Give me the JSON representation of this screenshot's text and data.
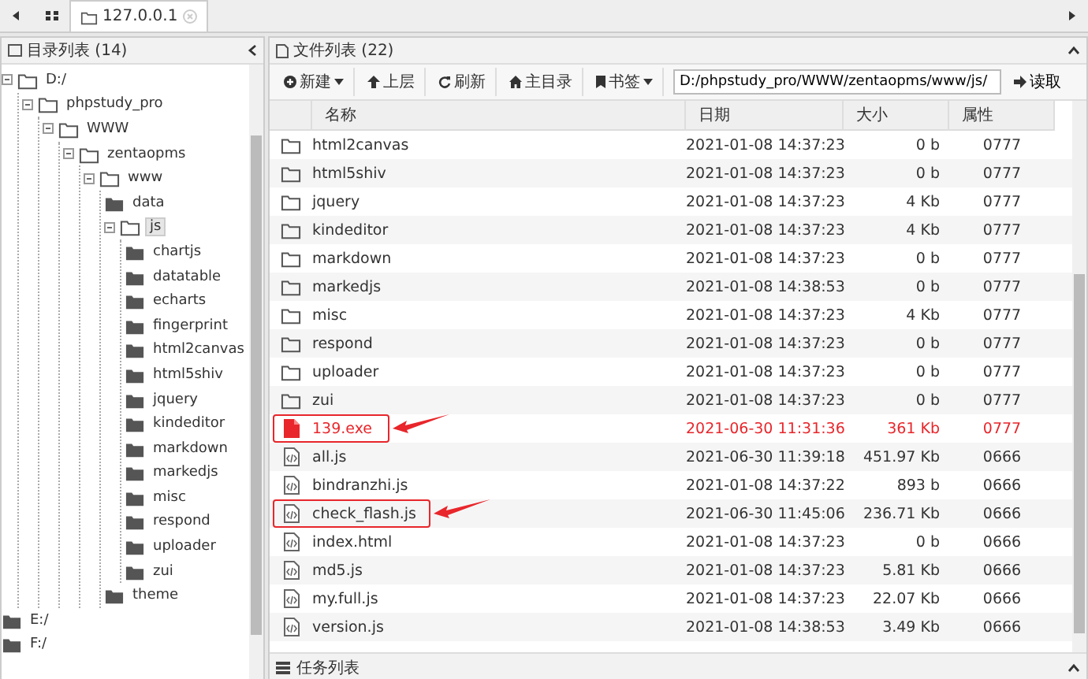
{
  "tabs": [
    {
      "label": "127.0.0.1",
      "selected": true
    }
  ],
  "directory_panel": {
    "title": "目录列表 (14)",
    "tree": [
      {
        "label": "D:/",
        "expanded": true,
        "selected": false,
        "children": [
          {
            "label": "phpstudy_pro",
            "expanded": true,
            "selected": false,
            "children": [
              {
                "label": "WWW",
                "expanded": true,
                "selected": false,
                "children": [
                  {
                    "label": "zentaopms",
                    "expanded": true,
                    "selected": false,
                    "children": [
                      {
                        "label": "www",
                        "expanded": true,
                        "selected": false,
                        "children": [
                          {
                            "label": "data",
                            "expanded": false,
                            "selected": false
                          },
                          {
                            "label": "js",
                            "expanded": true,
                            "selected": true,
                            "children": [
                              {
                                "label": "chartjs",
                                "expanded": false,
                                "selected": false
                              },
                              {
                                "label": "datatable",
                                "expanded": false,
                                "selected": false
                              },
                              {
                                "label": "echarts",
                                "expanded": false,
                                "selected": false
                              },
                              {
                                "label": "fingerprint",
                                "expanded": false,
                                "selected": false
                              },
                              {
                                "label": "html2canvas",
                                "expanded": false,
                                "selected": false
                              },
                              {
                                "label": "html5shiv",
                                "expanded": false,
                                "selected": false
                              },
                              {
                                "label": "jquery",
                                "expanded": false,
                                "selected": false
                              },
                              {
                                "label": "kindeditor",
                                "expanded": false,
                                "selected": false
                              },
                              {
                                "label": "markdown",
                                "expanded": false,
                                "selected": false
                              },
                              {
                                "label": "markedjs",
                                "expanded": false,
                                "selected": false
                              },
                              {
                                "label": "misc",
                                "expanded": false,
                                "selected": false
                              },
                              {
                                "label": "respond",
                                "expanded": false,
                                "selected": false
                              },
                              {
                                "label": "uploader",
                                "expanded": false,
                                "selected": false
                              },
                              {
                                "label": "zui",
                                "expanded": false,
                                "selected": false
                              }
                            ]
                          },
                          {
                            "label": "theme",
                            "expanded": false,
                            "selected": false
                          }
                        ]
                      }
                    ]
                  }
                ]
              }
            ]
          }
        ]
      },
      {
        "label": "E:/",
        "expanded": false,
        "selected": false
      },
      {
        "label": "F:/",
        "expanded": false,
        "selected": false
      }
    ]
  },
  "file_panel": {
    "title": "文件列表 (22)",
    "toolbar": [
      {
        "label": "新建",
        "kind": "new",
        "dropdown": true
      },
      {
        "label": "上层",
        "kind": "up",
        "dropdown": false
      },
      {
        "label": "刷新",
        "kind": "refresh",
        "dropdown": false
      },
      {
        "label": "主目录",
        "kind": "home",
        "dropdown": false
      },
      {
        "label": "书签",
        "kind": "bookmark",
        "dropdown": true
      }
    ],
    "path": "D:/phpstudy_pro/WWW/zentaopms/www/js/",
    "read_button": "读取",
    "columns": [
      "名称",
      "日期",
      "大小",
      "属性"
    ],
    "rows": [
      {
        "kind": "folder",
        "name": "html2canvas",
        "date": "2021-01-08 14:37:23",
        "size": "0 b",
        "mode": "0777",
        "highlighted": false
      },
      {
        "kind": "folder",
        "name": "html5shiv",
        "date": "2021-01-08 14:37:23",
        "size": "0 b",
        "mode": "0777",
        "highlighted": false
      },
      {
        "kind": "folder",
        "name": "jquery",
        "date": "2021-01-08 14:37:23",
        "size": "4 Kb",
        "mode": "0777",
        "highlighted": false
      },
      {
        "kind": "folder",
        "name": "kindeditor",
        "date": "2021-01-08 14:37:23",
        "size": "4 Kb",
        "mode": "0777",
        "highlighted": false
      },
      {
        "kind": "folder",
        "name": "markdown",
        "date": "2021-01-08 14:37:23",
        "size": "0 b",
        "mode": "0777",
        "highlighted": false
      },
      {
        "kind": "folder",
        "name": "markedjs",
        "date": "2021-01-08 14:38:53",
        "size": "0 b",
        "mode": "0777",
        "highlighted": false
      },
      {
        "kind": "folder",
        "name": "misc",
        "date": "2021-01-08 14:37:23",
        "size": "4 Kb",
        "mode": "0777",
        "highlighted": false
      },
      {
        "kind": "folder",
        "name": "respond",
        "date": "2021-01-08 14:37:23",
        "size": "0 b",
        "mode": "0777",
        "highlighted": false
      },
      {
        "kind": "folder",
        "name": "uploader",
        "date": "2021-01-08 14:37:23",
        "size": "0 b",
        "mode": "0777",
        "highlighted": false
      },
      {
        "kind": "folder",
        "name": "zui",
        "date": "2021-01-08 14:37:23",
        "size": "0 b",
        "mode": "0777",
        "highlighted": false
      },
      {
        "kind": "executable",
        "name": "139.exe",
        "date": "2021-06-30 11:31:36",
        "size": "361 Kb",
        "mode": "0777",
        "highlighted": true
      },
      {
        "kind": "script",
        "name": "all.js",
        "date": "2021-06-30 11:39:18",
        "size": "451.97 Kb",
        "mode": "0666",
        "highlighted": false
      },
      {
        "kind": "script",
        "name": "bindranzhi.js",
        "date": "2021-01-08 14:37:22",
        "size": "893 b",
        "mode": "0666",
        "highlighted": false
      },
      {
        "kind": "script",
        "name": "check_flash.js",
        "date": "2021-06-30 11:45:06",
        "size": "236.71 Kb",
        "mode": "0666",
        "highlighted": true
      },
      {
        "kind": "script",
        "name": "index.html",
        "date": "2021-01-08 14:37:23",
        "size": "0 b",
        "mode": "0666",
        "highlighted": false
      },
      {
        "kind": "script",
        "name": "md5.js",
        "date": "2021-01-08 14:37:23",
        "size": "5.81 Kb",
        "mode": "0666",
        "highlighted": false
      },
      {
        "kind": "script",
        "name": "my.full.js",
        "date": "2021-01-08 14:37:23",
        "size": "22.07 Kb",
        "mode": "0666",
        "highlighted": false
      },
      {
        "kind": "script",
        "name": "version.js",
        "date": "2021-01-08 14:38:53",
        "size": "3.49 Kb",
        "mode": "0666",
        "highlighted": false
      }
    ]
  },
  "task_panel": {
    "title": "任务列表"
  }
}
